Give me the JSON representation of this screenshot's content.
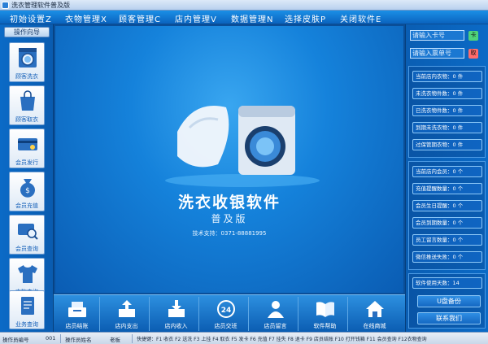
{
  "window": {
    "title": "洗衣管理软件普及版"
  },
  "menu": [
    {
      "label": "初始设置Z"
    },
    {
      "label": "衣物管理X"
    },
    {
      "label": "顾客管理C"
    },
    {
      "label": "店内管理V"
    },
    {
      "label": "数据管理N"
    },
    {
      "label": "选择皮肤P"
    },
    {
      "label": "关闭软件E"
    }
  ],
  "left": {
    "wizard": "操作向导",
    "tiles": [
      {
        "label": "顾客洗衣",
        "icon": "washing-machine-icon"
      },
      {
        "label": "顾客取衣",
        "icon": "shopping-bag-icon"
      },
      {
        "label": "会员发行",
        "icon": "member-card-icon"
      },
      {
        "label": "会员充值",
        "icon": "money-bag-icon"
      },
      {
        "label": "会员查询",
        "icon": "card-search-icon"
      },
      {
        "label": "衣物查询",
        "icon": "tshirt-icon"
      },
      {
        "label": "业务查询",
        "icon": "document-icon"
      }
    ]
  },
  "center": {
    "product_title": "洗衣收银软件",
    "edition": "普及版",
    "support": "技术支持：0371-88881995"
  },
  "bottom": [
    {
      "label": "店员结账",
      "icon": "cash-register-icon"
    },
    {
      "label": "店内支出",
      "icon": "box-out-icon"
    },
    {
      "label": "店内收入",
      "icon": "box-in-icon"
    },
    {
      "label": "店员交班",
      "icon": "clock-24-icon"
    },
    {
      "label": "店员留言",
      "icon": "person-icon"
    },
    {
      "label": "软件帮助",
      "icon": "book-icon"
    },
    {
      "label": "在线商城",
      "icon": "house-icon"
    }
  ],
  "right": {
    "card_placeholder": "请输入卡号",
    "card_btn": "卡",
    "ticket_placeholder": "请输入票单号",
    "ticket_btn": "取",
    "stats_clothes": [
      "当前店内衣物：0 件",
      "未洗衣物件数：0 件",
      "已洗衣物件数：0 件",
      "到期未洗衣物：0 件",
      "过保管期衣物：0 件"
    ],
    "stats_members": [
      "当前店内会员：0 个",
      "充值提醒数量：0 个",
      "会员生日提醒：0 个",
      "会员到期数量：0 个",
      "员工留言数量：0 个",
      "微信推送失败：0 个"
    ],
    "days_used": "软件使用天数：14",
    "backup_btn": "U盘备份",
    "contact_btn": "联系我们"
  },
  "status": {
    "operator_no_label": "操作员编号",
    "operator_no": "001",
    "operator_name_label": "操作员姓名",
    "operator_name": "老板",
    "shortcuts": "快捷键：F1 收衣 F2 送洗 F3 上挂 F4 取衣 F5 发卡 F6 充值 F7 挂失 F8 退卡 F9 店员结账 F10 打开钱箱 F11 会员查询 F12衣物查询"
  },
  "colors": {
    "accent": "#0b5fb4",
    "menubar": "#1b8fe6",
    "card_btn": "#4fd27a",
    "ticket_btn": "#ff6b6b"
  }
}
